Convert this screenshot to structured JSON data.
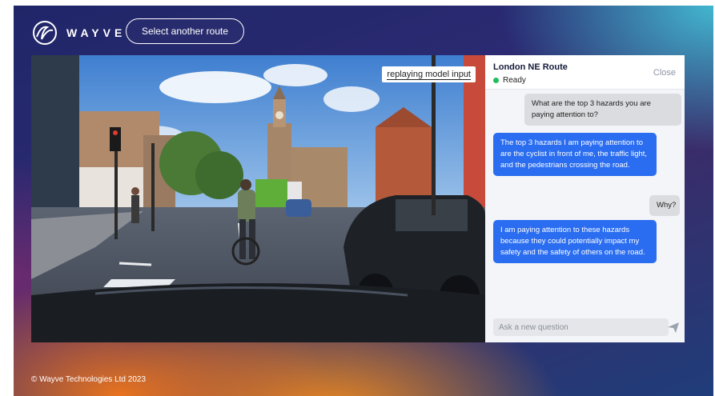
{
  "header": {
    "brand": "WAYVE",
    "route_button": "Select another route"
  },
  "video": {
    "tag": "replaying model input"
  },
  "chat": {
    "title": "London NE Route",
    "status": "Ready",
    "close_label": "Close",
    "messages": [
      {
        "role": "user",
        "text": "What are the top 3 hazards you are paying attention to?"
      },
      {
        "role": "assistant",
        "text": "The top 3 hazards I am paying attention to are the cyclist in front of me, the traffic light, and the pedestrians crossing the road."
      },
      {
        "role": "user",
        "text": "Why?"
      },
      {
        "role": "assistant",
        "text": "I am paying attention to these hazards because they could potentially impact my safety and the safety of others on the road."
      }
    ],
    "input_placeholder": "Ask a new question"
  },
  "footer": {
    "copyright": "© Wayve Technologies Ltd 2023"
  },
  "colors": {
    "accent": "#2a6df0",
    "status_ready": "#1fbf5c"
  },
  "icons": [
    "wayve-logo-icon",
    "send-icon",
    "status-dot-icon"
  ]
}
